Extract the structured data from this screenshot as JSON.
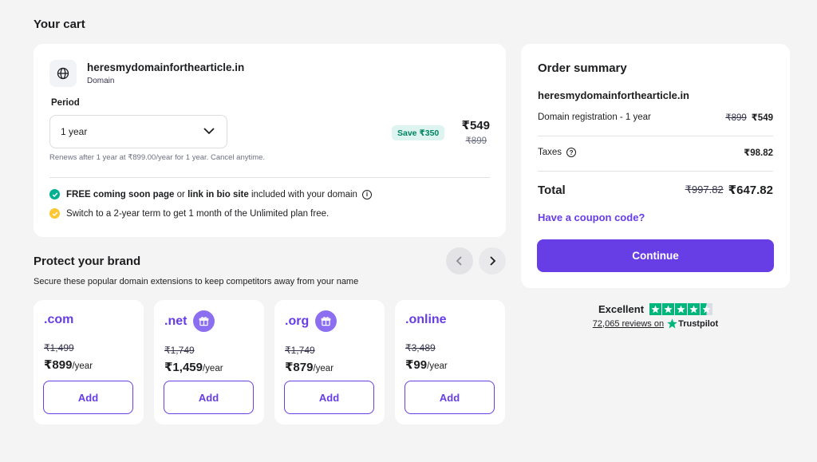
{
  "page": {
    "title": "Your cart"
  },
  "cart_item": {
    "domain": "heresmydomainforthearticle.in",
    "type": "Domain",
    "period_label": "Period",
    "period_value": "1 year",
    "save_badge": "Save ₹350",
    "price": "₹549",
    "old_price": "₹899",
    "renew_note": "Renews after 1 year at ₹899.00/year for 1 year. Cancel anytime.",
    "perk1": {
      "bold1": "FREE coming soon page",
      "mid": " or ",
      "bold2": "link in bio site",
      "rest": " included with your domain"
    },
    "perk2": "Switch to a 2-year term to get 1 month of the Unlimited plan free."
  },
  "protect": {
    "title": "Protect your brand",
    "subtitle": "Secure these popular domain extensions to keep competitors away from your name",
    "extensions": [
      {
        "name": ".com",
        "old": "₹1,499",
        "price": "₹899",
        "per": "/year",
        "gift": false,
        "add": "Add"
      },
      {
        "name": ".net",
        "old": "₹1,749",
        "price": "₹1,459",
        "per": "/year",
        "gift": true,
        "add": "Add"
      },
      {
        "name": ".org",
        "old": "₹1,749",
        "price": "₹879",
        "per": "/year",
        "gift": true,
        "add": "Add"
      },
      {
        "name": ".online",
        "old": "₹3,489",
        "price": "₹99",
        "per": "/year",
        "gift": false,
        "add": "Add"
      }
    ]
  },
  "summary": {
    "title": "Order summary",
    "domain": "heresmydomainforthearticle.in",
    "registration_label": "Domain registration - 1 year",
    "registration_old": "₹899",
    "registration_price": "₹549",
    "taxes_label": "Taxes",
    "taxes_value": "₹98.82",
    "total_label": "Total",
    "total_old": "₹997.82",
    "total_value": "₹647.82",
    "coupon": "Have a coupon code?",
    "continue": "Continue"
  },
  "trustpilot": {
    "rating": "Excellent",
    "stars": 4.5,
    "reviews": "72,065 reviews on",
    "brand": "Trustpilot"
  },
  "colors": {
    "accent": "#673de6",
    "success": "#00b090",
    "warning": "#ffc634",
    "trustpilot": "#00b67a"
  }
}
